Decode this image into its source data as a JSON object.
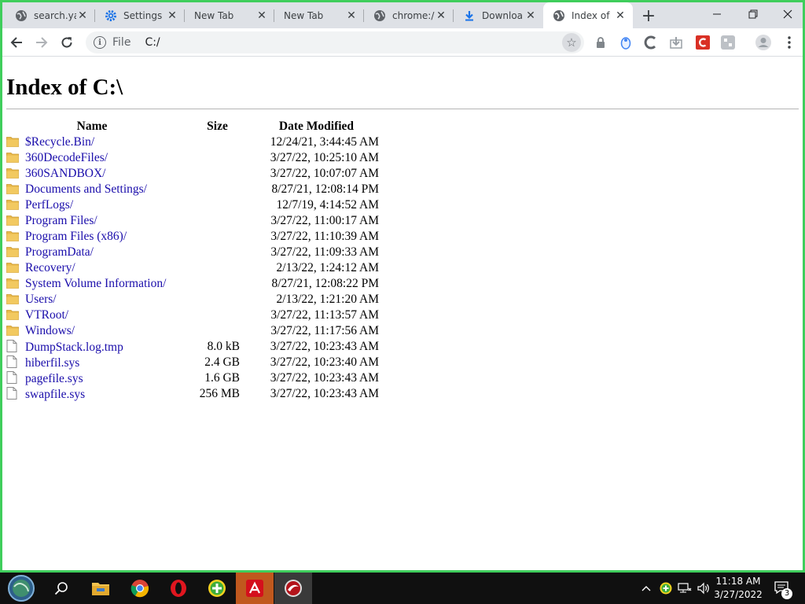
{
  "tabs": [
    {
      "label": "search.ya",
      "icon": "globe-icon"
    },
    {
      "label": "Settings",
      "icon": "gear-icon"
    },
    {
      "label": "New Tab",
      "icon": ""
    },
    {
      "label": "New Tab",
      "icon": ""
    },
    {
      "label": "chrome:/",
      "icon": "globe-icon"
    },
    {
      "label": "Downloa",
      "icon": "download-icon"
    },
    {
      "label": "Index of",
      "icon": "globe-icon",
      "active": true
    }
  ],
  "toolbar": {
    "scheme": "File",
    "url": "C:/"
  },
  "page": {
    "title": "Index of C:\\",
    "columns": {
      "name": "Name",
      "size": "Size",
      "date": "Date Modified"
    },
    "rows": [
      {
        "name": "$Recycle.Bin/",
        "size": "",
        "date": "12/24/21, 3:44:45 AM",
        "type": "folder"
      },
      {
        "name": "360DecodeFiles/",
        "size": "",
        "date": "3/27/22, 10:25:10 AM",
        "type": "folder"
      },
      {
        "name": "360SANDBOX/",
        "size": "",
        "date": "3/27/22, 10:07:07 AM",
        "type": "folder"
      },
      {
        "name": "Documents and Settings/",
        "size": "",
        "date": "8/27/21, 12:08:14 PM",
        "type": "folder"
      },
      {
        "name": "PerfLogs/",
        "size": "",
        "date": "12/7/19, 4:14:52 AM",
        "type": "folder"
      },
      {
        "name": "Program Files/",
        "size": "",
        "date": "3/27/22, 11:00:17 AM",
        "type": "folder"
      },
      {
        "name": "Program Files (x86)/",
        "size": "",
        "date": "3/27/22, 11:10:39 AM",
        "type": "folder"
      },
      {
        "name": "ProgramData/",
        "size": "",
        "date": "3/27/22, 11:09:33 AM",
        "type": "folder"
      },
      {
        "name": "Recovery/",
        "size": "",
        "date": "2/13/22, 1:24:12 AM",
        "type": "folder"
      },
      {
        "name": "System Volume Information/",
        "size": "",
        "date": "8/27/21, 12:08:22 PM",
        "type": "folder"
      },
      {
        "name": "Users/",
        "size": "",
        "date": "2/13/22, 1:21:20 AM",
        "type": "folder"
      },
      {
        "name": "VTRoot/",
        "size": "",
        "date": "3/27/22, 11:13:57 AM",
        "type": "folder"
      },
      {
        "name": "Windows/",
        "size": "",
        "date": "3/27/22, 11:17:56 AM",
        "type": "folder"
      },
      {
        "name": "DumpStack.log.tmp",
        "size": "8.0 kB",
        "date": "3/27/22, 10:23:43 AM",
        "type": "file"
      },
      {
        "name": "hiberfil.sys",
        "size": "2.4 GB",
        "date": "3/27/22, 10:23:40 AM",
        "type": "file"
      },
      {
        "name": "pagefile.sys",
        "size": "1.6 GB",
        "date": "3/27/22, 10:23:43 AM",
        "type": "file"
      },
      {
        "name": "swapfile.sys",
        "size": "256 MB",
        "date": "3/27/22, 10:23:43 AM",
        "type": "file"
      }
    ]
  },
  "taskbar": {
    "time": "11:18 AM",
    "date": "3/27/2022",
    "notification_count": "3"
  },
  "colors": {
    "window_border": "#3fce5c",
    "link": "#1a0dab",
    "folder": "#e8b84a",
    "tab_strip": "#dee1e6"
  }
}
